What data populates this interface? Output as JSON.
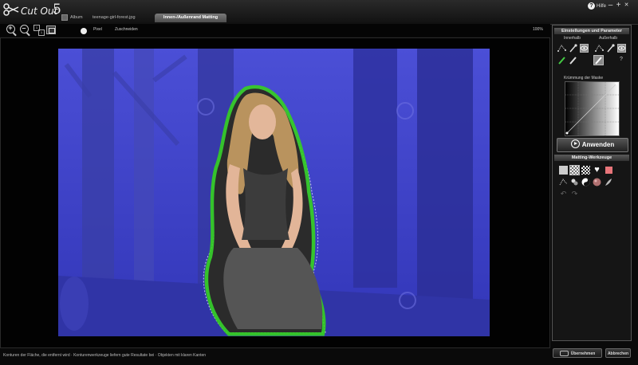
{
  "app": {
    "logo_text": "Cut Out",
    "version": "5"
  },
  "tabs": [
    {
      "label": "Album"
    },
    {
      "label": "teenage-girl-forest.jpg"
    },
    {
      "label": "Innen-/Außenrand Matting"
    }
  ],
  "window": {
    "help_label": "Hilfe",
    "minimize": "–",
    "maximize": "+",
    "close": "✕"
  },
  "toolbar": {
    "zoom_in": "+",
    "zoom_out": "–",
    "zoom_1to1_a": "1",
    "zoom_1to1_b": "1",
    "pixel_label": "Pixel",
    "fit_label": "Zuschneiden",
    "zoom_value": "100%"
  },
  "panel": {
    "settings_title": "Einstellungen und Parameter",
    "inside_label": "Innerhalb",
    "outside_label": "Außerhalb",
    "help_mark": "?",
    "curve_label": "Krümmung der Maske",
    "apply_label": "Anwenden",
    "matting_title": "Matting-Werkzeuge"
  },
  "status": {
    "text": "Konturen der Fläche, die entfernt wird · Konturenwerkzeuge liefern gute Resultate bei · Objekten mit klaren Kanten"
  },
  "buttons": {
    "accept": "Übernehmen",
    "cancel": "Abbrechen"
  },
  "colors": {
    "overlay": "#3c3cd2",
    "keep_outline": "#35d21e",
    "panel_border": "#555555"
  }
}
